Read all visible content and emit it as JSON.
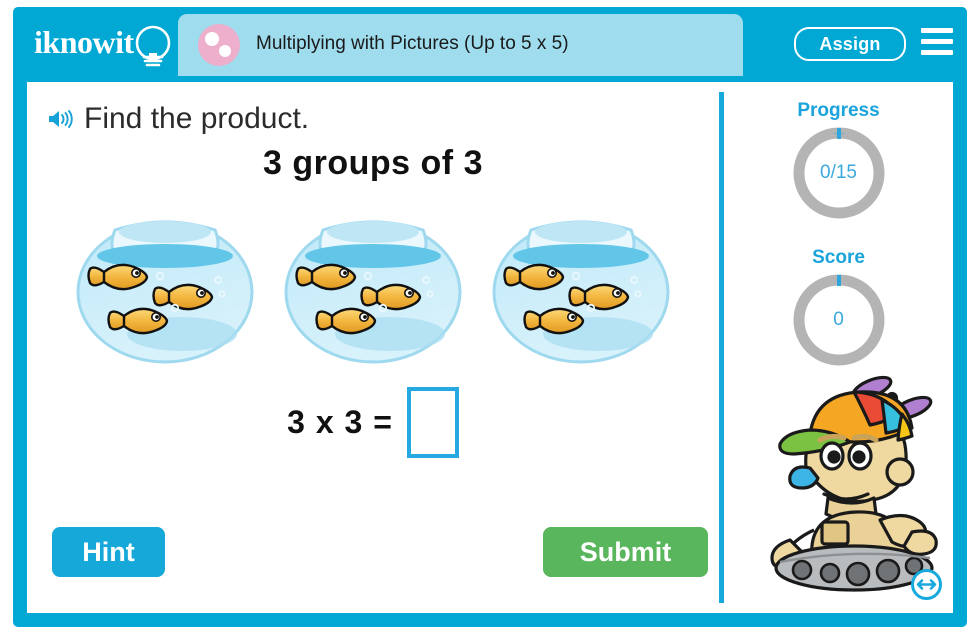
{
  "header": {
    "logo_text": "iknowit",
    "logo_icon": "lightbulb-icon",
    "title": "Multiplying with Pictures (Up to 5 x 5)",
    "badge_icon": "pink-dots-icon",
    "assign_label": "Assign",
    "menu_icon": "hamburger-menu-icon"
  },
  "lesson": {
    "audio_icon": "speaker-icon",
    "prompt": "Find the product.",
    "question": "3 groups of 3",
    "groups": 3,
    "items_per_group": 3,
    "item_icon": "fishbowl-icon",
    "equation": "3 x 3 =",
    "answer_value": "",
    "answer_placeholder": ""
  },
  "actions": {
    "hint_label": "Hint",
    "submit_label": "Submit"
  },
  "rail": {
    "progress_label": "Progress",
    "progress_value": "0/15",
    "score_label": "Score",
    "score_value": "0",
    "mascot_icon": "robot-mascot-icon",
    "resize_icon": "resize-horizontal-icon"
  },
  "colors": {
    "brand_cyan": "#00a8d3",
    "title_band": "#9fdced",
    "badge_pink": "#eeafcd",
    "submit_green": "#59b65c",
    "ring_gray": "#b4b4b4",
    "accent_blue": "#26a9e0"
  }
}
